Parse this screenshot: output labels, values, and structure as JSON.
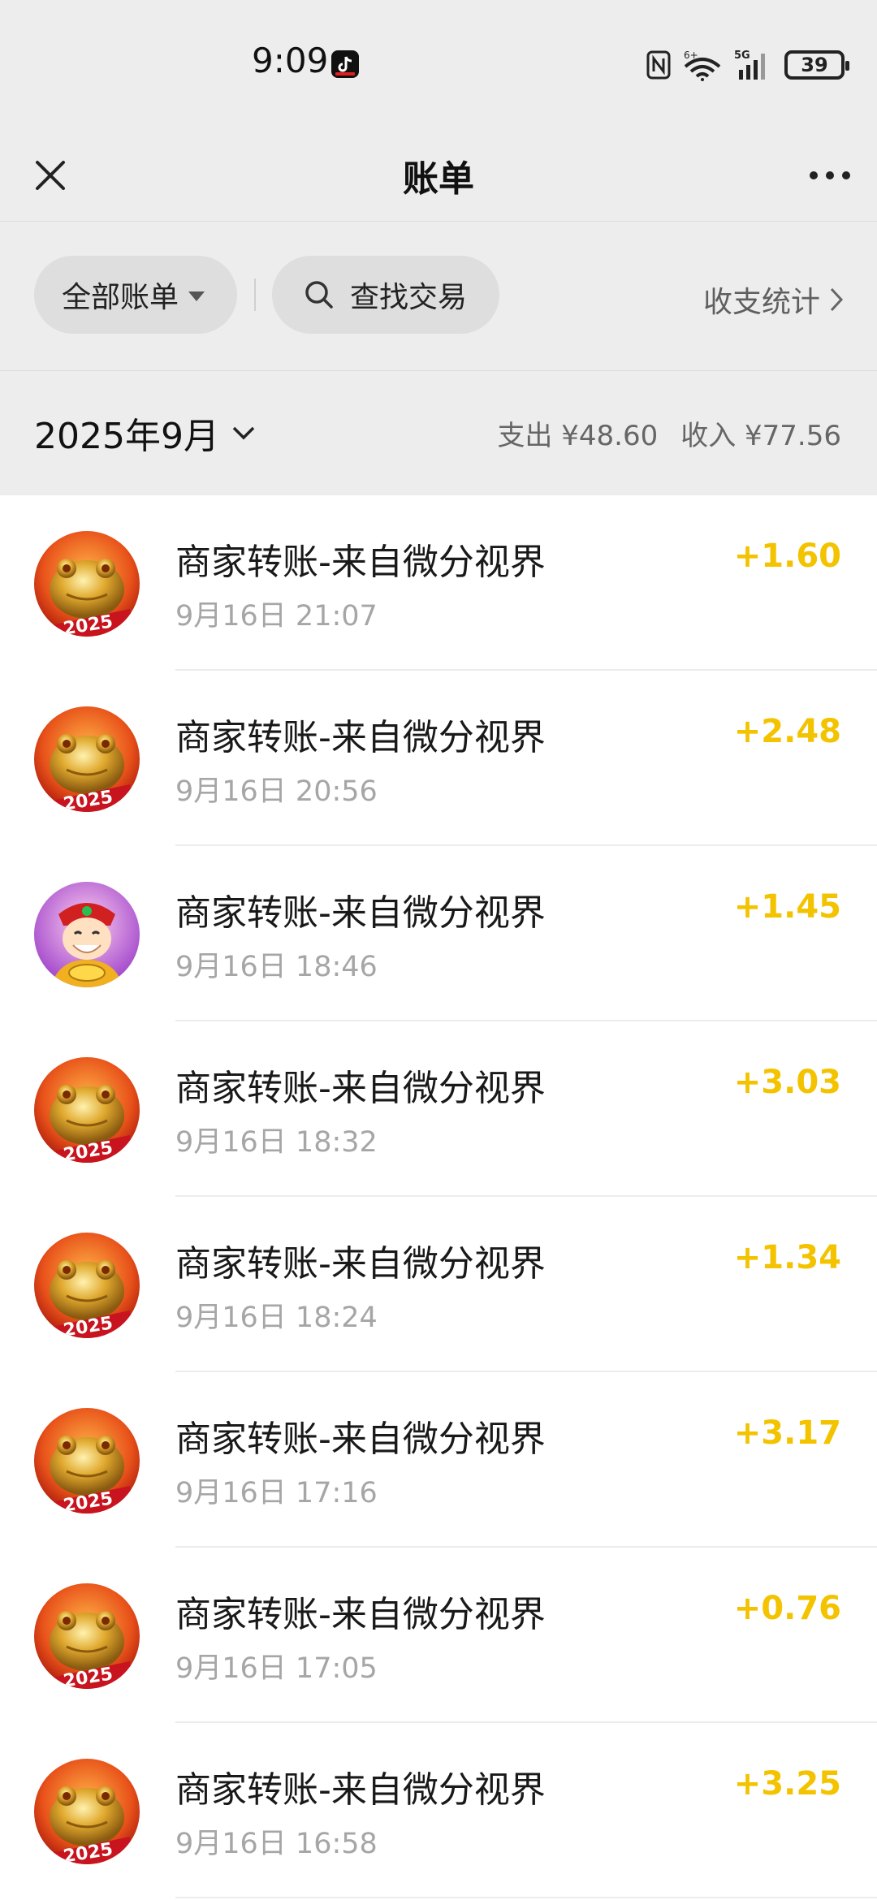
{
  "status_bar": {
    "time": "9:09",
    "battery": "39",
    "network": "5G",
    "wifi_label": "6+"
  },
  "nav": {
    "title": "账单"
  },
  "filters": {
    "all_bills": "全部账单",
    "search_label": "查找交易",
    "stats_link": "收支统计"
  },
  "month": {
    "label": "2025年9月",
    "expense": "支出 ¥48.60",
    "income": "收入 ¥77.56"
  },
  "colors": {
    "income_amount": "#f3c300",
    "background": "#ededed"
  },
  "transactions": [
    {
      "title": "商家转账-来自微分视界",
      "time": "9月16日 21:07",
      "amount": "+1.60",
      "avatar": "golden-toad"
    },
    {
      "title": "商家转账-来自微分视界",
      "time": "9月16日 20:56",
      "amount": "+2.48",
      "avatar": "golden-toad"
    },
    {
      "title": "商家转账-来自微分视界",
      "time": "9月16日 18:46",
      "amount": "+1.45",
      "avatar": "god-of-wealth"
    },
    {
      "title": "商家转账-来自微分视界",
      "time": "9月16日 18:32",
      "amount": "+3.03",
      "avatar": "golden-toad"
    },
    {
      "title": "商家转账-来自微分视界",
      "time": "9月16日 18:24",
      "amount": "+1.34",
      "avatar": "golden-toad"
    },
    {
      "title": "商家转账-来自微分视界",
      "time": "9月16日 17:16",
      "amount": "+3.17",
      "avatar": "golden-toad"
    },
    {
      "title": "商家转账-来自微分视界",
      "time": "9月16日 17:05",
      "amount": "+0.76",
      "avatar": "golden-toad"
    },
    {
      "title": "商家转账-来自微分视界",
      "time": "9月16日 16:58",
      "amount": "+3.25",
      "avatar": "golden-toad"
    }
  ]
}
